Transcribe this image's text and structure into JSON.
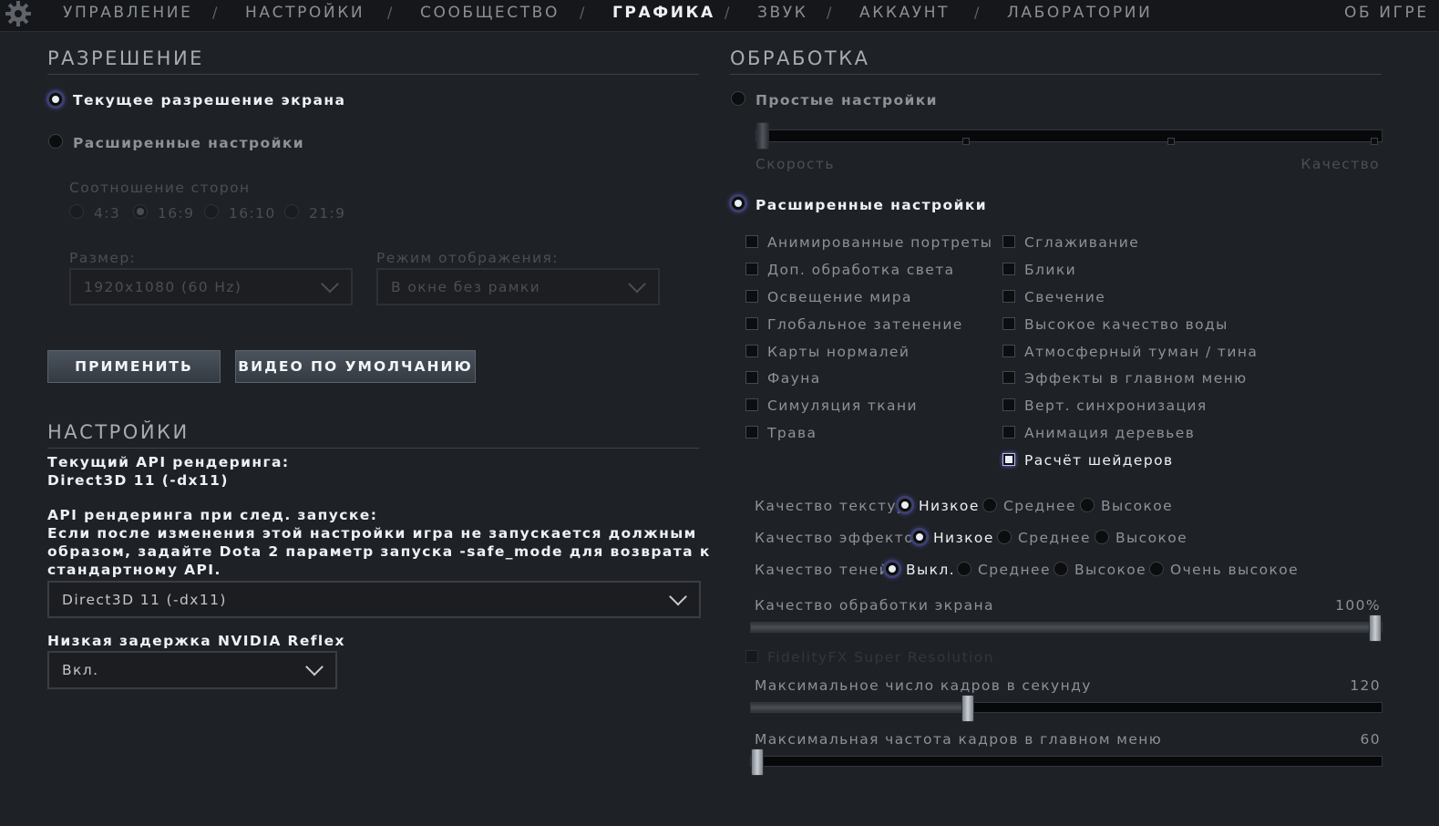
{
  "nav": {
    "items": [
      "УПРАВЛЕНИЕ",
      "НАСТРОЙКИ",
      "СООБЩЕСТВО",
      "ГРАФИКА",
      "ЗВУК",
      "АККАУНТ",
      "ЛАБОРАТОРИИ"
    ],
    "about": "ОБ ИГРЕ",
    "separator": "/",
    "active": "ГРАФИКА"
  },
  "resolution": {
    "heading": "РАЗРЕШЕНИЕ",
    "current_label": "Текущее разрешение экрана",
    "advanced_label": "Расширенные настройки",
    "aspect_label": "Соотношение сторон",
    "aspects": [
      "4:3",
      "16:9",
      "16:10",
      "21:9"
    ],
    "aspect_selected": "16:9",
    "size_label": "Размер:",
    "size_value": "1920x1080 (60 Hz)",
    "mode_label": "Режим отображения:",
    "mode_value": "В окне без рамки",
    "apply_label": "ПРИМЕНИТЬ",
    "default_label": "ВИДЕО ПО УМОЛЧАНИЮ"
  },
  "settings": {
    "heading": "НАСТРОЙКИ",
    "current_api_label": "Текущий API рендеринга:",
    "current_api_value": "Direct3D 11 (-dx11)",
    "next_api_label": "API рендеринга при след. запуске:",
    "warning_line1": "Если после изменения этой настройки игра не запускается должным",
    "warning_line2": "образом, задайте Dota 2 параметр запуска -safe_mode для возврата к",
    "warning_line3": "стандартному API.",
    "api_value": "Direct3D 11 (-dx11)",
    "reflex_label": "Низкая задержка NVIDIA Reflex",
    "reflex_value": "Вкл."
  },
  "processing": {
    "heading": "ОБРАБОТКА",
    "simple_label": "Простые настройки",
    "speed_label": "Скорость",
    "quality_label": "Качество",
    "advanced_label": "Расширенные настройки",
    "checkboxes_left": [
      {
        "label": "Анимированные портреты",
        "checked": false
      },
      {
        "label": "Доп. обработка света",
        "checked": false
      },
      {
        "label": "Освещение мира",
        "checked": false
      },
      {
        "label": "Глобальное затенение",
        "checked": false
      },
      {
        "label": "Карты нормалей",
        "checked": false
      },
      {
        "label": "Фауна",
        "checked": false
      },
      {
        "label": "Симуляция ткани",
        "checked": false
      },
      {
        "label": "Трава",
        "checked": false
      }
    ],
    "checkboxes_right": [
      {
        "label": "Сглаживание",
        "checked": false
      },
      {
        "label": "Блики",
        "checked": false
      },
      {
        "label": "Свечение",
        "checked": false
      },
      {
        "label": "Высокое качество воды",
        "checked": false
      },
      {
        "label": "Атмосферный туман / тина",
        "checked": false
      },
      {
        "label": "Эффекты в главном меню",
        "checked": false
      },
      {
        "label": "Верт. синхронизация",
        "checked": false
      },
      {
        "label": "Анимация деревьев",
        "checked": false
      },
      {
        "label": "Расчёт шейдеров",
        "checked": true
      }
    ],
    "texture_label": "Качество текстур",
    "texture_options": [
      "Низкое",
      "Среднее",
      "Высокое"
    ],
    "effects_label": "Качество эффектов",
    "effects_options": [
      "Низкое",
      "Среднее",
      "Высокое"
    ],
    "shadow_label": "Качество теней",
    "shadow_options": [
      "Выкл.",
      "Среднее",
      "Высокое",
      "Очень высокое"
    ],
    "screen_quality_label": "Качество обработки экрана",
    "screen_quality_value": "100%",
    "screen_quality_fraction": 1.0,
    "fsr_label": "FidelityFX Super Resolution",
    "fps_label": "Максимальное число кадров в секунду",
    "fps_value": "120",
    "fps_fraction": 0.34,
    "menu_fps_label": "Максимальная частота кадров в главном меню",
    "menu_fps_value": "60",
    "menu_fps_fraction": 0.0,
    "preset_fraction": 0.0
  }
}
